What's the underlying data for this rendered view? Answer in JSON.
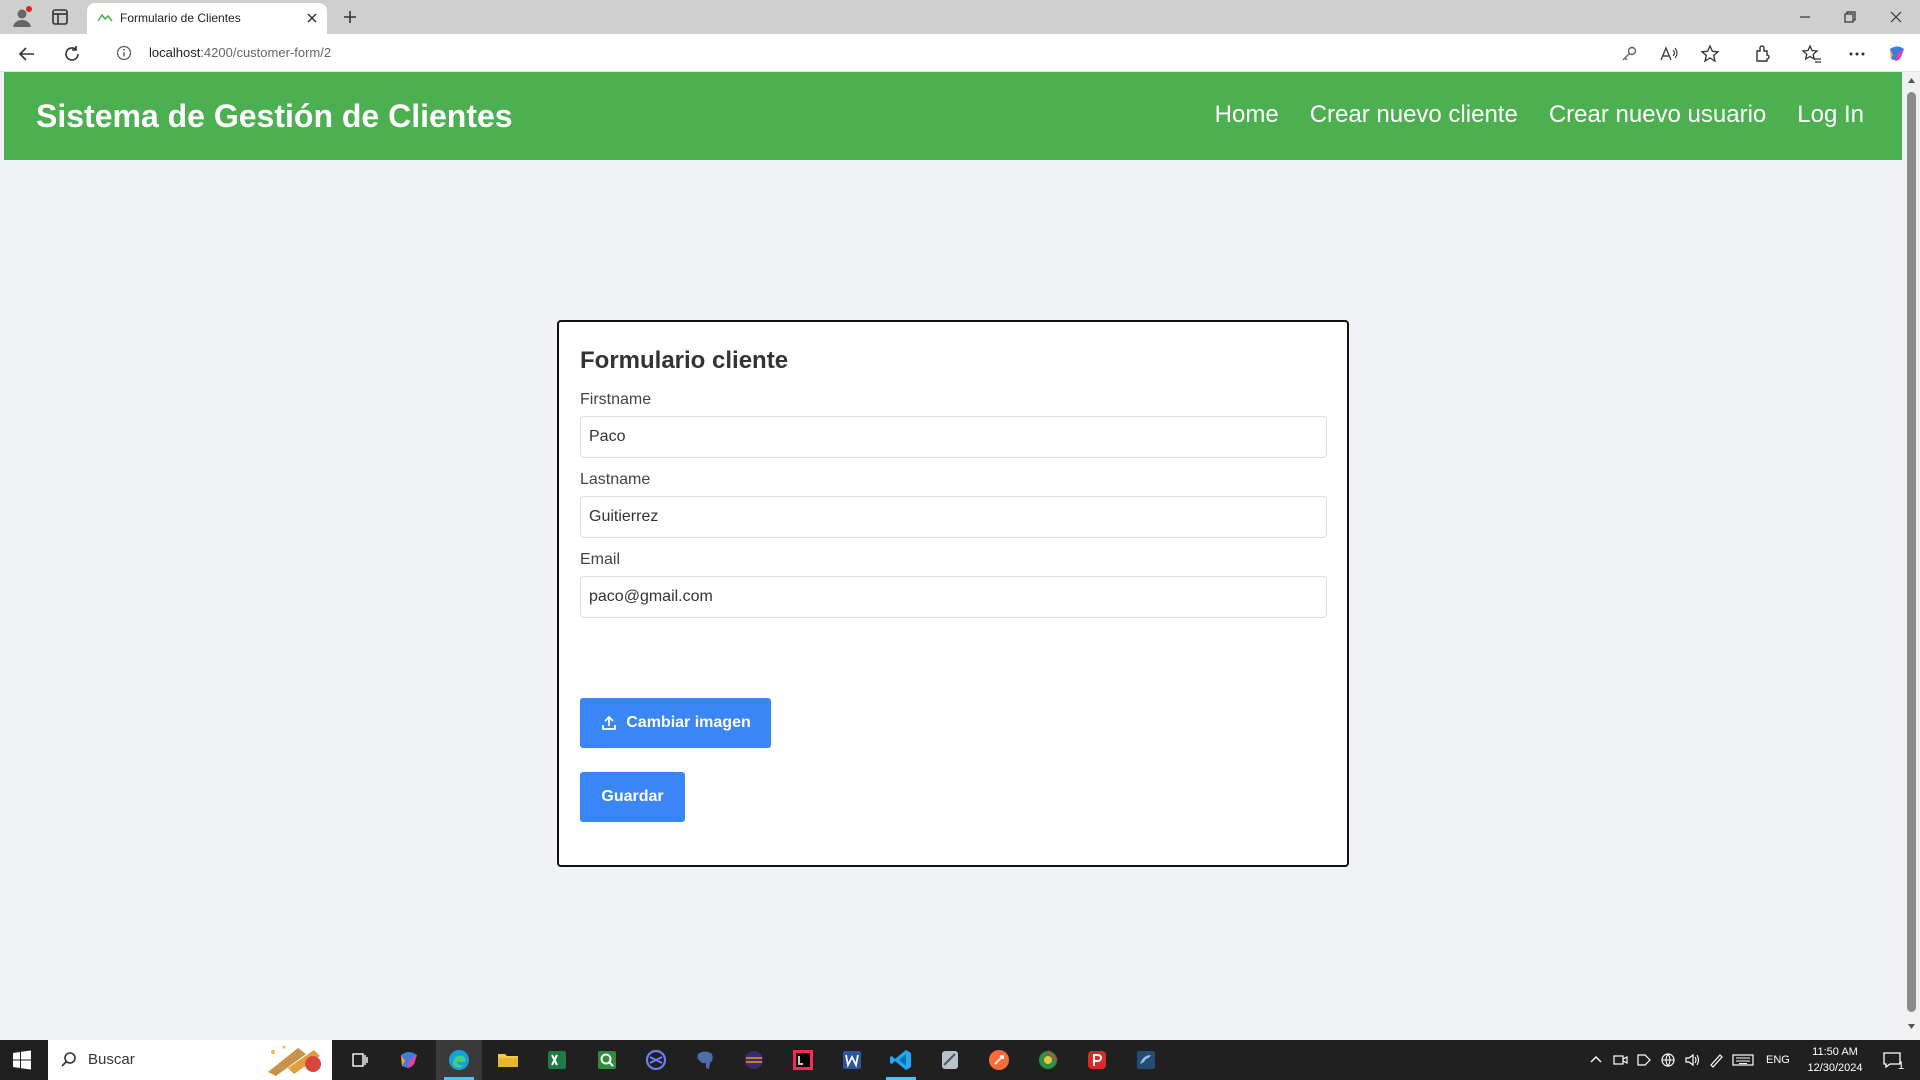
{
  "browser": {
    "tab_title": "Formulario de Clientes",
    "url_host": "localhost",
    "url_rest": ":4200/customer-form/2"
  },
  "navbar": {
    "brand": "Sistema de Gestión de Clientes",
    "links": [
      "Home",
      "Crear nuevo cliente",
      "Crear nuevo usuario",
      "Log In"
    ]
  },
  "form": {
    "title": "Formulario cliente",
    "firstname_label": "Firstname",
    "firstname_value": "Paco",
    "lastname_label": "Lastname",
    "lastname_value": "Guitierrez",
    "email_label": "Email",
    "email_value": "paco@gmail.com",
    "upload_button": "Cambiar imagen",
    "save_button": "Guardar"
  },
  "taskbar": {
    "search_placeholder": "Buscar",
    "language": "ENG",
    "time": "11:50 AM",
    "date": "12/30/2024",
    "notification_count": "1"
  },
  "colors": {
    "navbar": "#4caf50",
    "primary_button": "#3b86f7",
    "page_background": "#f0f2f5"
  }
}
